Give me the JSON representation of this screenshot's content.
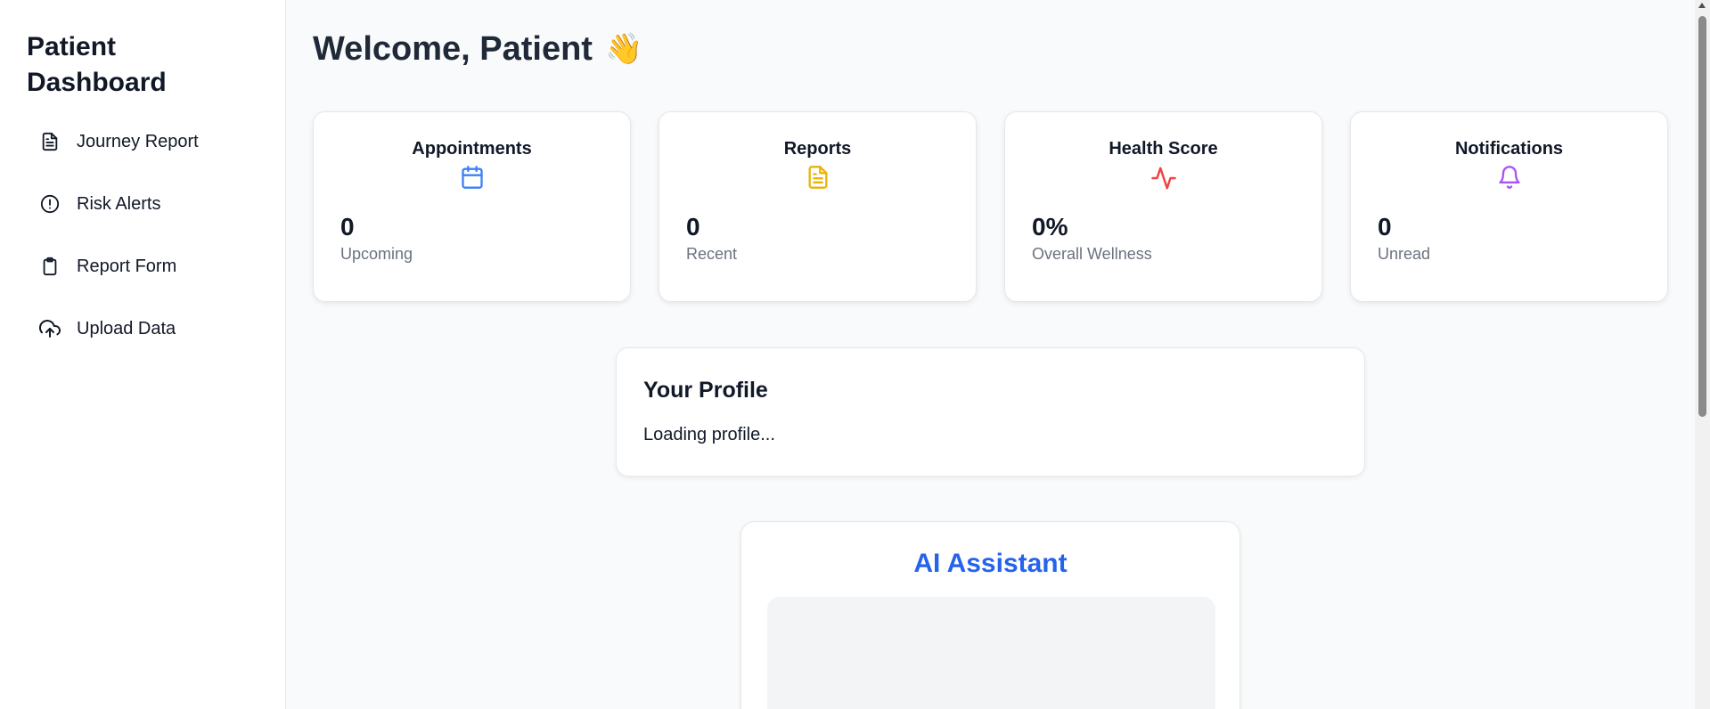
{
  "sidebar": {
    "title": "Patient Dashboard",
    "items": [
      {
        "label": "Journey Report",
        "icon": "document-icon"
      },
      {
        "label": "Risk Alerts",
        "icon": "alert-circle-icon"
      },
      {
        "label": "Report Form",
        "icon": "clipboard-icon"
      },
      {
        "label": "Upload Data",
        "icon": "cloud-upload-icon"
      }
    ]
  },
  "header": {
    "welcome": "Welcome, Patient",
    "emoji": "👋"
  },
  "stats": [
    {
      "title": "Appointments",
      "icon": "calendar-icon",
      "color": "#3b82f6",
      "value": "0",
      "sub": "Upcoming"
    },
    {
      "title": "Reports",
      "icon": "file-text-icon",
      "color": "#eab308",
      "value": "0",
      "sub": "Recent"
    },
    {
      "title": "Health Score",
      "icon": "activity-icon",
      "color": "#ef4444",
      "value": "0%",
      "sub": "Overall Wellness"
    },
    {
      "title": "Notifications",
      "icon": "bell-icon",
      "color": "#a855f7",
      "value": "0",
      "sub": "Unread"
    }
  ],
  "profile": {
    "title": "Your Profile",
    "status": "Loading profile..."
  },
  "ai_assistant": {
    "title": "AI Assistant",
    "accent": "#2563eb"
  }
}
